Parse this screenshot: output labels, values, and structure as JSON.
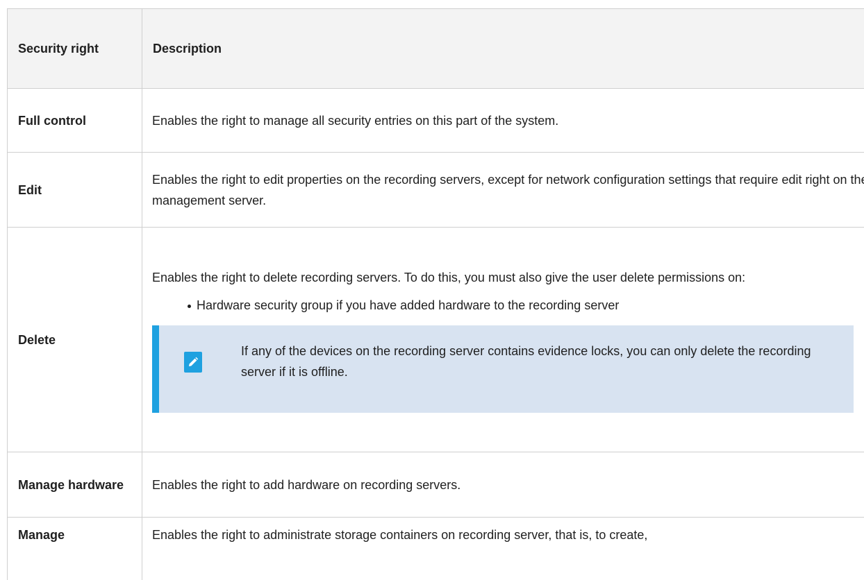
{
  "table": {
    "headers": {
      "right": "Security right",
      "description": "Description"
    },
    "rows": [
      {
        "right": "Full control",
        "description": "Enables the right to manage all security entries on this part of the system."
      },
      {
        "right": "Edit",
        "description": "Enables the right to edit properties on the recording servers, except for network configuration settings that require edit right on the management server."
      },
      {
        "right": "Delete",
        "description": "Enables the right to delete recording servers. To do this, you must also give the user delete permissions on:",
        "bullets": [
          "Hardware security group if you have added hardware to the recording server"
        ],
        "note": {
          "icon": "pencil-icon",
          "text": "If any of the devices on the recording server contains evidence locks, you can only delete the recording server if it is offline."
        }
      },
      {
        "right": "Manage hardware",
        "description": "Enables the right to add hardware on recording servers."
      },
      {
        "right": "Manage",
        "description": "Enables the right to administrate storage containers on recording server, that is, to create,"
      }
    ]
  },
  "colors": {
    "border": "#cfcfcf",
    "header_bg": "#f3f3f3",
    "note_bg": "#d8e3f1",
    "note_accent": "#1fa1e0"
  }
}
